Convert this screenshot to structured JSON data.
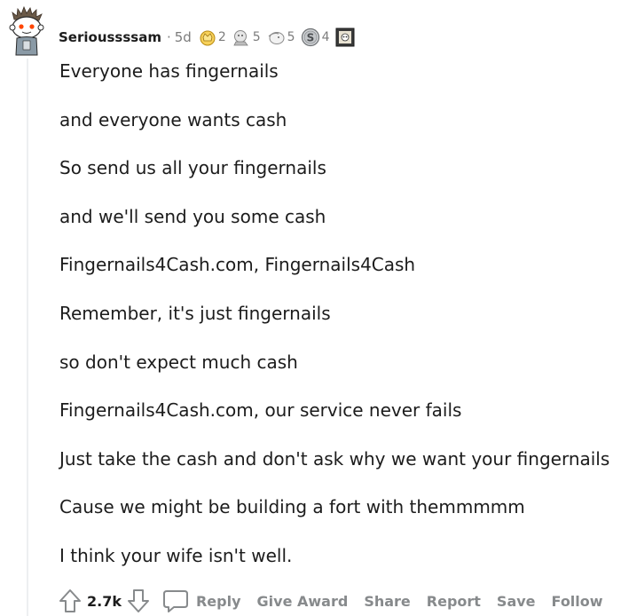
{
  "comment": {
    "username": "Serioussssam",
    "separator": "·",
    "age": "5d",
    "awards": [
      {
        "icon": "crown-award-icon",
        "count": "2"
      },
      {
        "icon": "wholesome-award-icon",
        "count": "5"
      },
      {
        "icon": "facepalm-award-icon",
        "count": "5"
      },
      {
        "icon": "silver-award-icon",
        "count": "4"
      },
      {
        "icon": "framed-award-icon",
        "count": ""
      }
    ],
    "lines": [
      "Everyone has fingernails",
      "and everyone wants cash",
      "So send us all your fingernails",
      "and we'll send you some cash",
      "Fingernails4Cash.com, Fingernails4Cash",
      "Remember, it's just fingernails",
      "so don't expect much cash",
      "Fingernails4Cash.com, our service never fails",
      "Just take the cash and don't ask why we want your fingernails",
      "Cause we might be building a fort with themmmmm",
      "I think your wife isn't well."
    ]
  },
  "actions": {
    "score": "2.7k",
    "reply_label": "Reply",
    "give_award_label": "Give Award",
    "share_label": "Share",
    "report_label": "Report",
    "save_label": "Save",
    "follow_label": "Follow"
  },
  "colors": {
    "text": "#1c1c1c",
    "meta": "#7c7c7c",
    "action": "#878a8c",
    "thread_line": "#edeff1"
  }
}
